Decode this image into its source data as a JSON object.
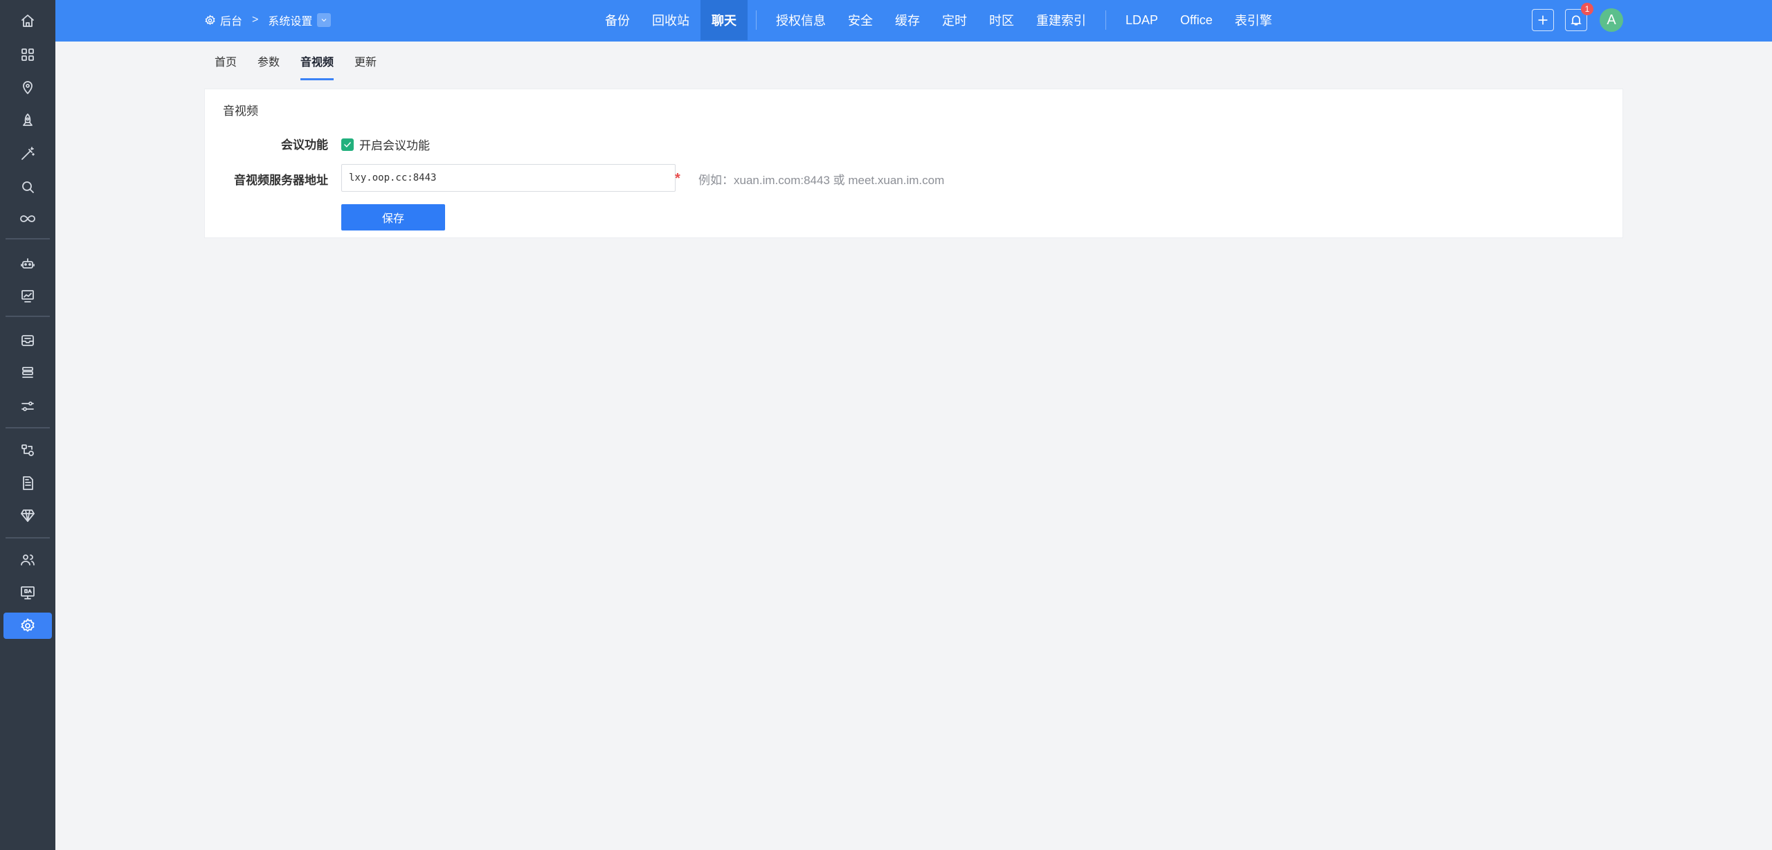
{
  "sidebar": {
    "items": [
      {
        "icon": "home-icon"
      },
      {
        "icon": "apps-grid-icon"
      },
      {
        "icon": "location-pin-icon"
      },
      {
        "icon": "rocket-icon"
      },
      {
        "icon": "magic-wand-icon"
      },
      {
        "icon": "search-icon"
      },
      {
        "icon": "infinity-icon"
      },
      {
        "icon": "robot-icon"
      },
      {
        "icon": "presentation-chart-icon"
      },
      {
        "icon": "inbox-tray-icon"
      },
      {
        "icon": "layers-stack-icon"
      },
      {
        "icon": "sliders-icon"
      },
      {
        "icon": "flow-chart-icon"
      },
      {
        "icon": "document-icon"
      },
      {
        "icon": "diamond-icon"
      },
      {
        "icon": "users-icon"
      },
      {
        "icon": "qa-monitor-icon"
      },
      {
        "icon": "gear-icon",
        "active": true
      }
    ]
  },
  "topbar": {
    "breadcrumb_root": "后台",
    "breadcrumb_current": "系统设置",
    "nav_group_1": [
      "备份",
      "回收站",
      "聊天"
    ],
    "nav_group_2": [
      "授权信息",
      "安全",
      "缓存",
      "定时",
      "时区",
      "重建索引"
    ],
    "nav_group_3": [
      "LDAP",
      "Office",
      "表引擎"
    ],
    "active_nav": "聊天",
    "notification_count": "1",
    "avatar_letter": "A"
  },
  "tabs": {
    "items": [
      "首页",
      "参数",
      "音视频",
      "更新"
    ],
    "active": "音视频"
  },
  "card": {
    "title": "音视频",
    "meeting_label": "会议功能",
    "meeting_checkbox_label": "开启会议功能",
    "meeting_enabled": true,
    "server_label": "音视频服务器地址",
    "server_value": "lxy.oop.cc:8443",
    "required_mark": "*",
    "hint": "例如：xuan.im.com:8443 或 meet.xuan.im.com",
    "save_label": "保存"
  },
  "colors": {
    "topbar": "#3b88f5",
    "sidebar": "#313a46",
    "accent": "#2f7cf6",
    "checkbox": "#22b07d"
  }
}
